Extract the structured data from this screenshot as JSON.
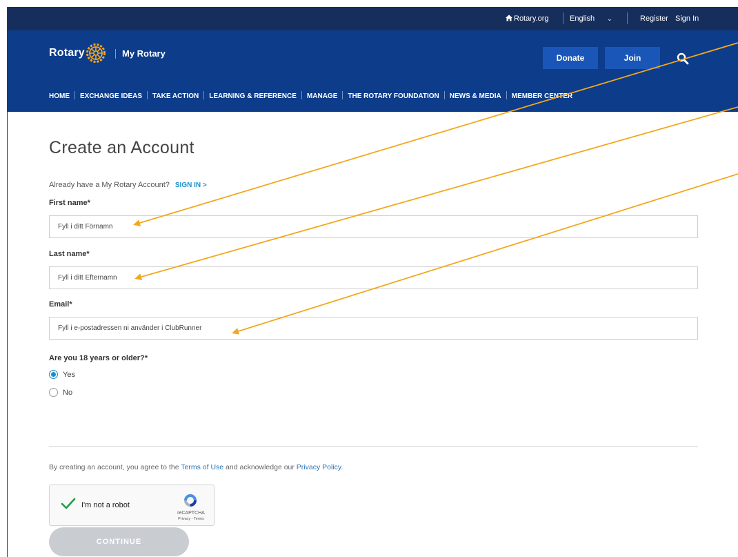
{
  "utility_bar": {
    "rotary_org": "Rotary.org",
    "language": "English",
    "register": "Register",
    "sign_in": "Sign In"
  },
  "header": {
    "logo_text": "Rotary",
    "site_name": "My Rotary",
    "donate": "Donate",
    "join": "Join"
  },
  "nav": {
    "items": [
      "HOME",
      "EXCHANGE IDEAS",
      "TAKE ACTION",
      "LEARNING & REFERENCE",
      "MANAGE",
      "THE ROTARY FOUNDATION",
      "NEWS & MEDIA",
      "MEMBER CENTER"
    ]
  },
  "form": {
    "title": "Create an Account",
    "already_text": "Already have a My Rotary Account?",
    "sign_in_link": "SIGN IN >",
    "first_name_label": "First name*",
    "first_name_placeholder": "Fyll i ditt Förnamn",
    "last_name_label": "Last name*",
    "last_name_placeholder": "Fyll i ditt Efternamn",
    "email_label": "Email*",
    "email_placeholder": "Fyll i e-postadressen ni använder i ClubRunner",
    "age_question": "Are you 18 years or older?*",
    "age_options": [
      {
        "label": "Yes",
        "selected": true
      },
      {
        "label": "No",
        "selected": false
      }
    ],
    "agree_prefix": "By creating an account, you agree to the ",
    "terms_link": "Terms of Use",
    "agree_middle": " and acknowledge our ",
    "privacy_link": "Privacy Policy",
    "agree_suffix": ".",
    "captcha_label": "I'm not a robot",
    "captcha_brand": "reCAPTCHA",
    "captcha_links": "Privacy - Terms",
    "continue": "CONTINUE"
  },
  "colors": {
    "util_bar_bg": "#162e5c",
    "header_bg": "#0c3c8a",
    "button_bg": "#1a56b8",
    "link_blue": "#1a8fc9",
    "annotation_arrow": "#f2a81d",
    "continue_disabled": "#c9cdd2"
  },
  "icons": {
    "home": "home-icon",
    "language_chevron": "chevron-down-icon",
    "search": "search-icon",
    "captcha_check": "checkmark-icon",
    "captcha_logo": "recaptcha-icon"
  }
}
